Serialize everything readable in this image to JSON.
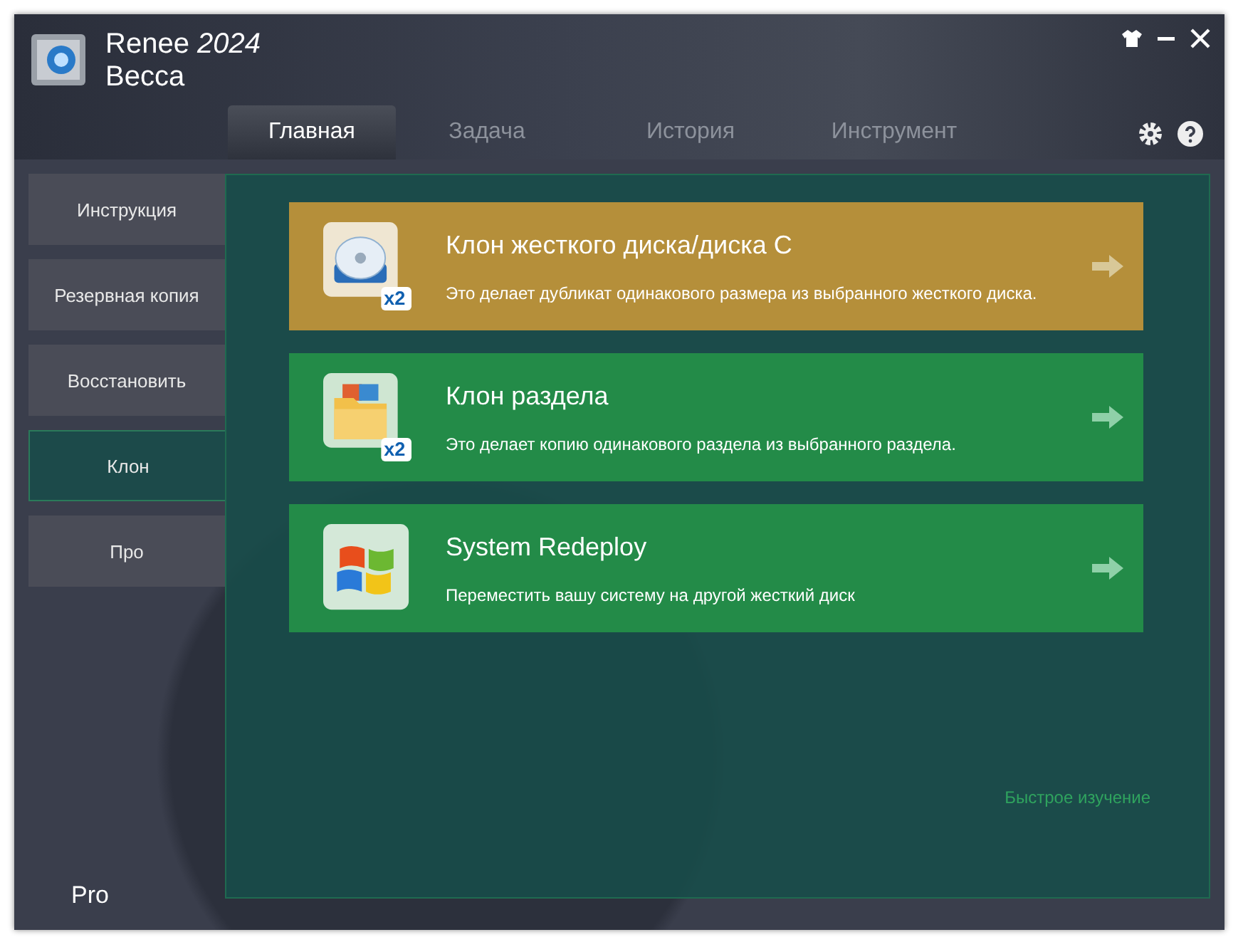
{
  "window": {
    "title": "Renee *2024*",
    "subtitle": "Becca"
  },
  "tabs": [
    {
      "label": "Главная",
      "selected": true
    },
    {
      "label": "Задача",
      "selected": false
    },
    {
      "label": "История",
      "selected": false
    },
    {
      "label": "Инструмент",
      "selected": false
    }
  ],
  "sidebar": {
    "items": [
      {
        "label": "Инструкция",
        "selected": false
      },
      {
        "label": "Резервная копия",
        "selected": false
      },
      {
        "label": "Восстановить",
        "selected": false
      },
      {
        "label": "Клон",
        "selected": true
      },
      {
        "label": "Про",
        "selected": false
      }
    ],
    "footer": "Pro"
  },
  "cards": [
    {
      "kind": "disk",
      "title": "Клон жесткого диска/диска C",
      "description": "Это делает дубликат одинакового размера из выбранного жесткого диска.",
      "highlighted": true,
      "badge": "x2"
    },
    {
      "kind": "folder",
      "title": "Клон раздела",
      "description": "Это делает копию одинакового раздела из выбранного раздела.",
      "highlighted": false,
      "badge": "x2"
    },
    {
      "kind": "windows",
      "title": "System Redeploy",
      "description": "Переместить вашу систему на другой жесткий диск",
      "highlighted": false
    }
  ],
  "quick_tour_link": "Быстрое изучение"
}
